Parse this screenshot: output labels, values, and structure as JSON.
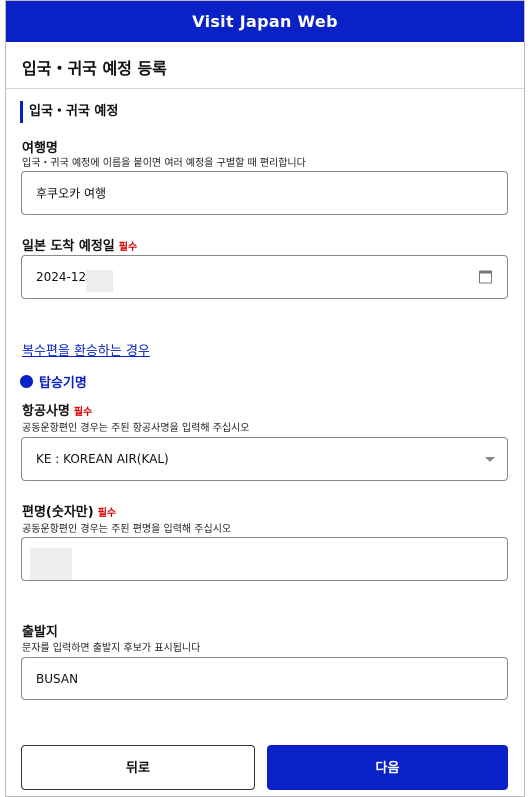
{
  "app": {
    "title": "Visit Japan Web"
  },
  "page": {
    "title": "입국・귀국 예정 등록"
  },
  "section": {
    "title": "입국・귀국 예정"
  },
  "trip_name": {
    "label": "여행명",
    "hint": "입국・귀국 예정에 이름을 붙이면 여러 예정을 구별할 때 편리합니다",
    "value": "후쿠오카 여행"
  },
  "arrival_date": {
    "label": "일본 도착 예정일",
    "required": "필수",
    "value": "2024-12",
    "icon": "calendar-icon"
  },
  "multi_flight_link": "복수편을 환승하는 경우",
  "flight_section": {
    "title": "탑승기명"
  },
  "airline": {
    "label": "항공사명",
    "required": "필수",
    "hint": "공동운항편인 경우는 주된 항공사명을 입력해 주십시오",
    "value": "KE : KOREAN AIR(KAL)",
    "icon": "dropdown-caret-icon"
  },
  "flight_number": {
    "label": "편명(숫자만)",
    "required": "필수",
    "hint": "공동운항편인 경우는 주된 편명을 입력해 주십시오",
    "value": ""
  },
  "departure": {
    "label": "출발지",
    "hint": "문자를 입력하면 출발지 후보가 표시됩니다",
    "value": "BUSAN"
  },
  "buttons": {
    "back": "뒤로",
    "next": "다음"
  },
  "colors": {
    "brand": "#0a22c5",
    "required": "#dd0000"
  }
}
